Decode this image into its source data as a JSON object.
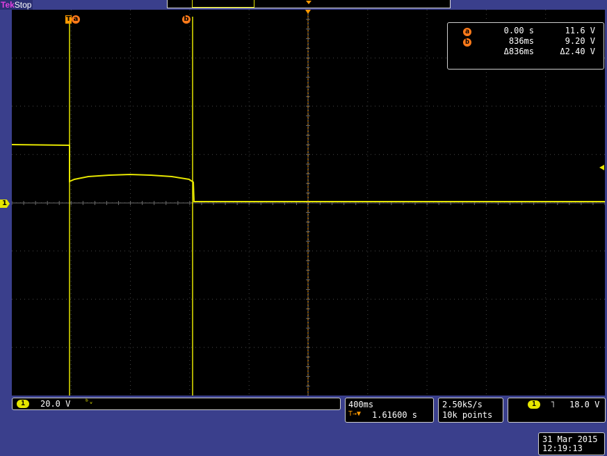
{
  "header": {
    "brand": "Tek",
    "status": "Stop"
  },
  "cursors": {
    "a": {
      "label": "a",
      "trigger_badge": "T"
    },
    "b": {
      "label": "b"
    }
  },
  "cursor_readout": {
    "row_a": {
      "badge": "a",
      "time": "0.00 s",
      "voltage": "11.6 V"
    },
    "row_b": {
      "badge": "b",
      "time": "836ms",
      "voltage": "9.20 V"
    },
    "row_delta": {
      "time": "Δ836ms",
      "voltage": "Δ2.40 V"
    }
  },
  "channel_marker": {
    "label": "1"
  },
  "channel_settings": {
    "channel": "1",
    "scale": "20.0 V",
    "bandwidth_symbol": "ᵇᵥ"
  },
  "timebase": {
    "scale": "400ms",
    "trigger_position_prefix": "T→▼",
    "trigger_position": "1.61600 s"
  },
  "acquisition": {
    "sample_rate": "2.50kS/s",
    "record_length": "10k points"
  },
  "trigger": {
    "channel": "1",
    "slope_symbol": "˥",
    "level": "18.0 V"
  },
  "datetime": {
    "date": "31 Mar 2015",
    "time": "12:19:13"
  },
  "colors": {
    "trace": "#e6e600",
    "cursor_badge": "#ff7a1a",
    "background": "#3a3f8c",
    "trigger_marker": "#ff9a00"
  }
}
